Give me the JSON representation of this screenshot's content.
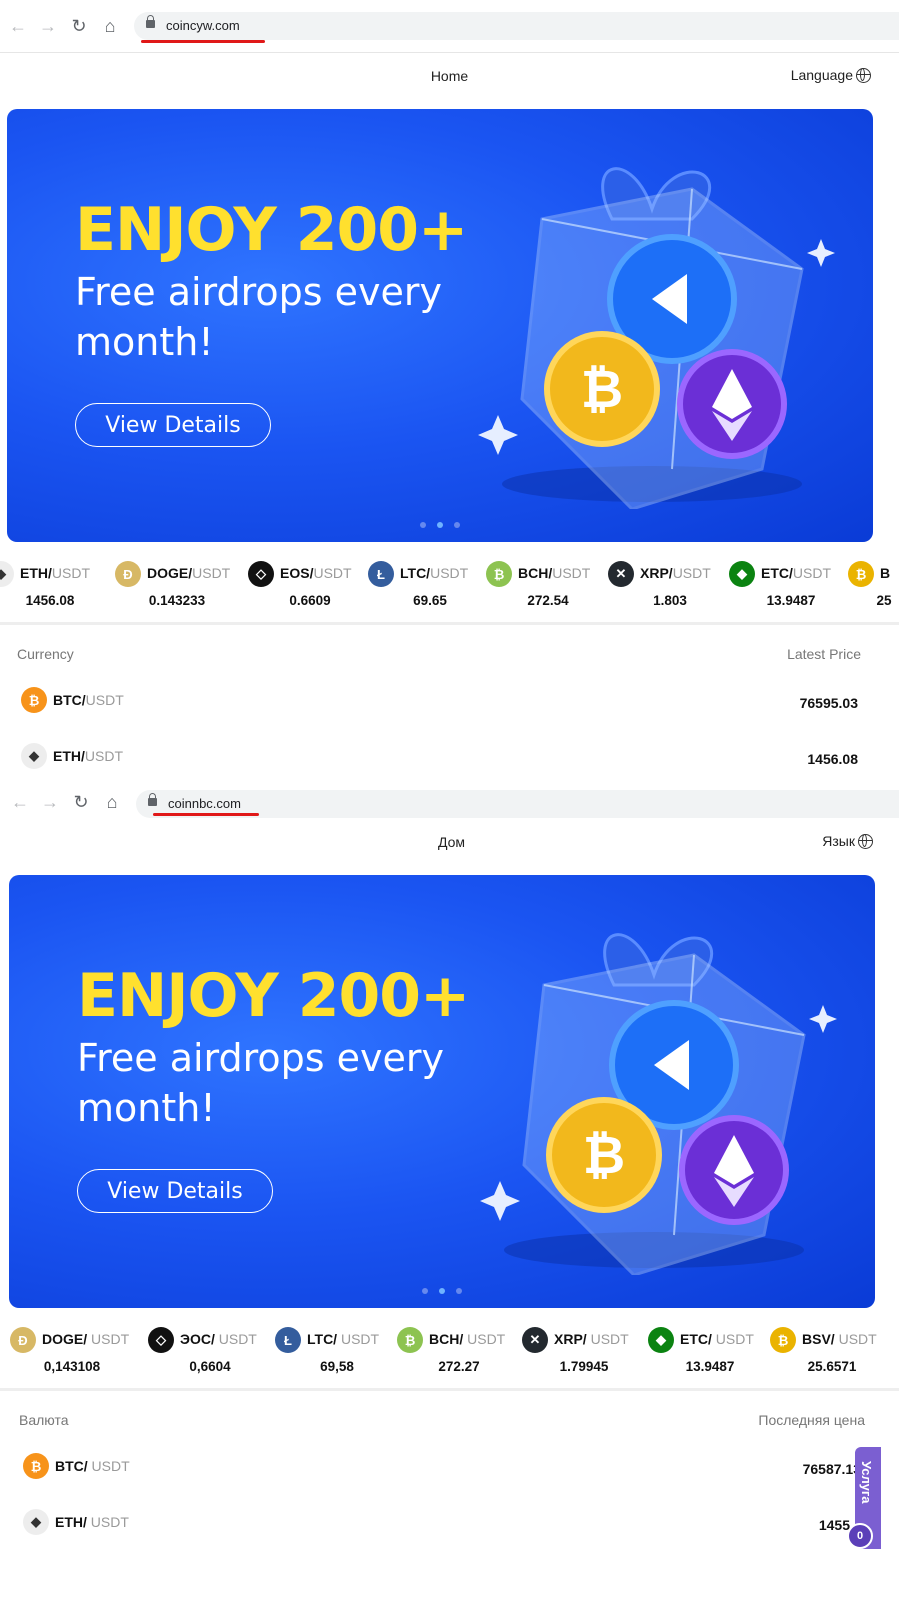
{
  "top": {
    "url": "coincyw.com",
    "nav": {
      "home": "Home",
      "language": "Language"
    },
    "banner": {
      "headline": "ENJOY 200+",
      "subtitle": "Free airdrops every month!",
      "button": "View Details"
    },
    "ticker": [
      {
        "base": "ETH/",
        "quote": "USDT",
        "price": "1456.08",
        "icon": "eth-icon"
      },
      {
        "base": "DOGE/",
        "quote": "USDT",
        "price": "0.143233",
        "icon": "doge-icon"
      },
      {
        "base": "EOS/",
        "quote": "USDT",
        "price": "0.6609",
        "icon": "eos-icon"
      },
      {
        "base": "LTC/",
        "quote": "USDT",
        "price": "69.65",
        "icon": "ltc-icon"
      },
      {
        "base": "BCH/",
        "quote": "USDT",
        "price": "272.54",
        "icon": "bch-icon"
      },
      {
        "base": "XRP/",
        "quote": "USDT",
        "price": "1.803",
        "icon": "xrp-icon"
      },
      {
        "base": "ETC/",
        "quote": "USDT",
        "price": "13.9487",
        "icon": "etc-icon"
      },
      {
        "base": "B",
        "quote": "",
        "price": "25",
        "icon": "bsv-icon"
      }
    ],
    "table": {
      "col_currency": "Currency",
      "col_price": "Latest Price",
      "rows": [
        {
          "base": "BTC/",
          "quote": "USDT",
          "price": "76595.03",
          "icon": "btc-icon"
        },
        {
          "base": "ETH/",
          "quote": "USDT",
          "price": "1456.08",
          "icon": "eth-icon"
        }
      ]
    }
  },
  "bottom": {
    "url": "coinnbc.com",
    "nav": {
      "home": "Дом",
      "language": "Язык"
    },
    "banner": {
      "headline": "ENJOY 200+",
      "subtitle": "Free airdrops every month!",
      "button": "View Details"
    },
    "ticker": [
      {
        "base": "DOGE/",
        "quote": " USDT",
        "price": "0,143108",
        "icon": "doge-icon"
      },
      {
        "base": "ЭОС/",
        "quote": " USDT",
        "price": "0,6604",
        "icon": "eos-icon"
      },
      {
        "base": "LTC/",
        "quote": " USDT",
        "price": "69,58",
        "icon": "ltc-icon"
      },
      {
        "base": "BCH/",
        "quote": " USDT",
        "price": "272.27",
        "icon": "bch-icon"
      },
      {
        "base": "XRP/",
        "quote": " USDT",
        "price": "1.79945",
        "icon": "xrp-icon"
      },
      {
        "base": "ETC/",
        "quote": " USDT",
        "price": "13.9487",
        "icon": "etc-icon"
      },
      {
        "base": "BSV/",
        "quote": " USDT",
        "price": "25.6571",
        "icon": "bsv-icon"
      }
    ],
    "table": {
      "col_currency": "Валюта",
      "col_price": "Последняя цена",
      "rows": [
        {
          "base": "BTC/",
          "quote": " USDT",
          "price": "76587.13",
          "icon": "btc-icon"
        },
        {
          "base": "ETH/",
          "quote": " USDT",
          "price": "1455",
          "icon": "eth-icon"
        }
      ]
    },
    "service": {
      "label": "Услуга",
      "count": "0"
    }
  },
  "colors": {
    "banner_blue": "#1b55f2",
    "headline_yellow": "#ffe02e",
    "url_underline": "#e01818",
    "service_purple": "#7b5fd1"
  }
}
